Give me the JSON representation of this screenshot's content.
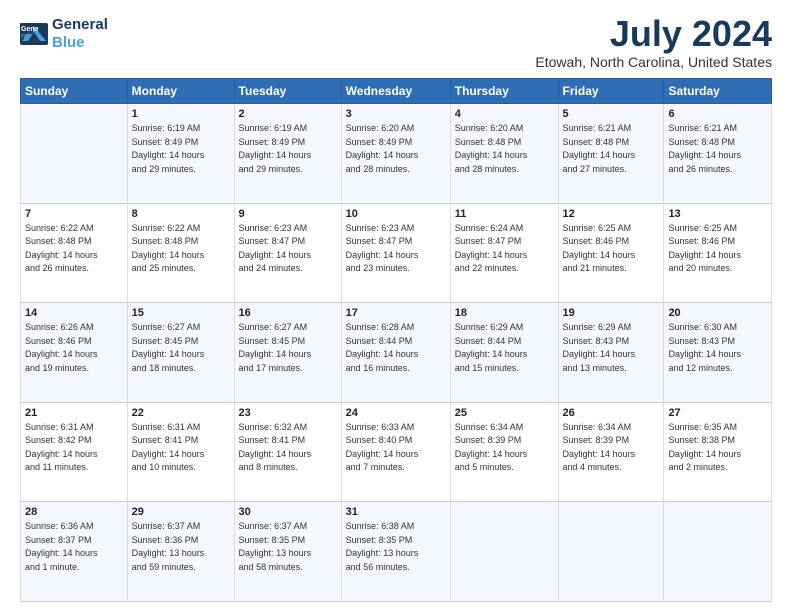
{
  "logo": {
    "line1": "General",
    "line2": "Blue",
    "arrow_color": "#4a9fd4"
  },
  "title": {
    "month_year": "July 2024",
    "location": "Etowah, North Carolina, United States"
  },
  "headers": [
    "Sunday",
    "Monday",
    "Tuesday",
    "Wednesday",
    "Thursday",
    "Friday",
    "Saturday"
  ],
  "weeks": [
    [
      {
        "day": "",
        "info": ""
      },
      {
        "day": "1",
        "info": "Sunrise: 6:19 AM\nSunset: 8:49 PM\nDaylight: 14 hours\nand 29 minutes."
      },
      {
        "day": "2",
        "info": "Sunrise: 6:19 AM\nSunset: 8:49 PM\nDaylight: 14 hours\nand 29 minutes."
      },
      {
        "day": "3",
        "info": "Sunrise: 6:20 AM\nSunset: 8:49 PM\nDaylight: 14 hours\nand 28 minutes."
      },
      {
        "day": "4",
        "info": "Sunrise: 6:20 AM\nSunset: 8:48 PM\nDaylight: 14 hours\nand 28 minutes."
      },
      {
        "day": "5",
        "info": "Sunrise: 6:21 AM\nSunset: 8:48 PM\nDaylight: 14 hours\nand 27 minutes."
      },
      {
        "day": "6",
        "info": "Sunrise: 6:21 AM\nSunset: 8:48 PM\nDaylight: 14 hours\nand 26 minutes."
      }
    ],
    [
      {
        "day": "7",
        "info": "Sunrise: 6:22 AM\nSunset: 8:48 PM\nDaylight: 14 hours\nand 26 minutes."
      },
      {
        "day": "8",
        "info": "Sunrise: 6:22 AM\nSunset: 8:48 PM\nDaylight: 14 hours\nand 25 minutes."
      },
      {
        "day": "9",
        "info": "Sunrise: 6:23 AM\nSunset: 8:47 PM\nDaylight: 14 hours\nand 24 minutes."
      },
      {
        "day": "10",
        "info": "Sunrise: 6:23 AM\nSunset: 8:47 PM\nDaylight: 14 hours\nand 23 minutes."
      },
      {
        "day": "11",
        "info": "Sunrise: 6:24 AM\nSunset: 8:47 PM\nDaylight: 14 hours\nand 22 minutes."
      },
      {
        "day": "12",
        "info": "Sunrise: 6:25 AM\nSunset: 8:46 PM\nDaylight: 14 hours\nand 21 minutes."
      },
      {
        "day": "13",
        "info": "Sunrise: 6:25 AM\nSunset: 8:46 PM\nDaylight: 14 hours\nand 20 minutes."
      }
    ],
    [
      {
        "day": "14",
        "info": "Sunrise: 6:26 AM\nSunset: 8:46 PM\nDaylight: 14 hours\nand 19 minutes."
      },
      {
        "day": "15",
        "info": "Sunrise: 6:27 AM\nSunset: 8:45 PM\nDaylight: 14 hours\nand 18 minutes."
      },
      {
        "day": "16",
        "info": "Sunrise: 6:27 AM\nSunset: 8:45 PM\nDaylight: 14 hours\nand 17 minutes."
      },
      {
        "day": "17",
        "info": "Sunrise: 6:28 AM\nSunset: 8:44 PM\nDaylight: 14 hours\nand 16 minutes."
      },
      {
        "day": "18",
        "info": "Sunrise: 6:29 AM\nSunset: 8:44 PM\nDaylight: 14 hours\nand 15 minutes."
      },
      {
        "day": "19",
        "info": "Sunrise: 6:29 AM\nSunset: 8:43 PM\nDaylight: 14 hours\nand 13 minutes."
      },
      {
        "day": "20",
        "info": "Sunrise: 6:30 AM\nSunset: 8:43 PM\nDaylight: 14 hours\nand 12 minutes."
      }
    ],
    [
      {
        "day": "21",
        "info": "Sunrise: 6:31 AM\nSunset: 8:42 PM\nDaylight: 14 hours\nand 11 minutes."
      },
      {
        "day": "22",
        "info": "Sunrise: 6:31 AM\nSunset: 8:41 PM\nDaylight: 14 hours\nand 10 minutes."
      },
      {
        "day": "23",
        "info": "Sunrise: 6:32 AM\nSunset: 8:41 PM\nDaylight: 14 hours\nand 8 minutes."
      },
      {
        "day": "24",
        "info": "Sunrise: 6:33 AM\nSunset: 8:40 PM\nDaylight: 14 hours\nand 7 minutes."
      },
      {
        "day": "25",
        "info": "Sunrise: 6:34 AM\nSunset: 8:39 PM\nDaylight: 14 hours\nand 5 minutes."
      },
      {
        "day": "26",
        "info": "Sunrise: 6:34 AM\nSunset: 8:39 PM\nDaylight: 14 hours\nand 4 minutes."
      },
      {
        "day": "27",
        "info": "Sunrise: 6:35 AM\nSunset: 8:38 PM\nDaylight: 14 hours\nand 2 minutes."
      }
    ],
    [
      {
        "day": "28",
        "info": "Sunrise: 6:36 AM\nSunset: 8:37 PM\nDaylight: 14 hours\nand 1 minute."
      },
      {
        "day": "29",
        "info": "Sunrise: 6:37 AM\nSunset: 8:36 PM\nDaylight: 13 hours\nand 59 minutes."
      },
      {
        "day": "30",
        "info": "Sunrise: 6:37 AM\nSunset: 8:35 PM\nDaylight: 13 hours\nand 58 minutes."
      },
      {
        "day": "31",
        "info": "Sunrise: 6:38 AM\nSunset: 8:35 PM\nDaylight: 13 hours\nand 56 minutes."
      },
      {
        "day": "",
        "info": ""
      },
      {
        "day": "",
        "info": ""
      },
      {
        "day": "",
        "info": ""
      }
    ]
  ]
}
